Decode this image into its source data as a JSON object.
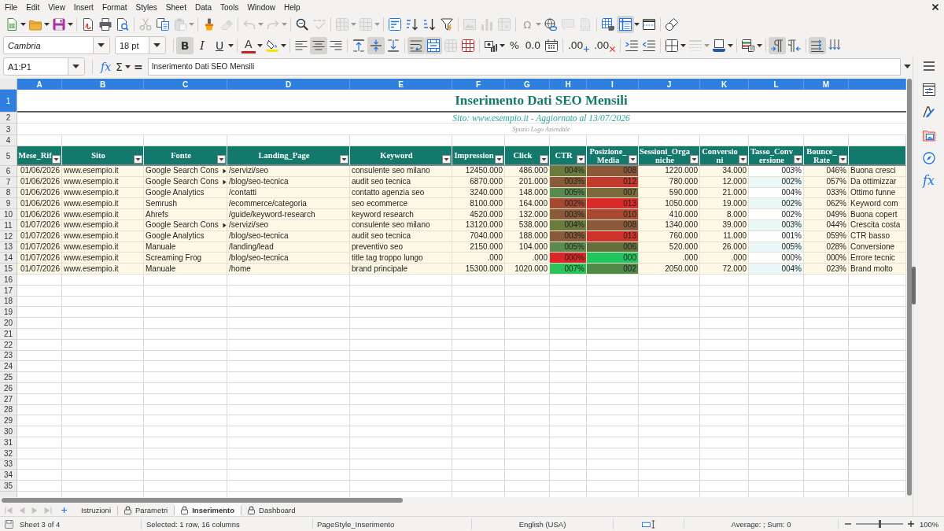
{
  "menu": [
    "File",
    "Edit",
    "View",
    "Insert",
    "Format",
    "Styles",
    "Sheet",
    "Data",
    "Tools",
    "Window",
    "Help"
  ],
  "standard_toolbar": [
    [
      {
        "pressed": false,
        "disabled": false
      },
      {
        "pressed": false,
        "disabled": false
      },
      {
        "pressed": false,
        "disabled": false
      }
    ],
    [
      {
        "pressed": false,
        "disabled": false
      },
      {
        "pressed": false,
        "disabled": false
      },
      {
        "pressed": false,
        "disabled": false
      }
    ],
    [
      {
        "pressed": false,
        "disabled": true
      },
      {
        "pressed": false,
        "disabled": false
      },
      {
        "pressed": false,
        "disabled": true
      }
    ],
    [
      {
        "pressed": false,
        "disabled": false
      },
      {
        "pressed": false,
        "disabled": true
      }
    ],
    [
      {
        "pressed": false,
        "disabled": true
      },
      {
        "pressed": false,
        "disabled": true
      }
    ],
    [
      {
        "pressed": false,
        "disabled": false
      },
      {
        "pressed": false,
        "disabled": true
      }
    ],
    [
      {
        "pressed": false,
        "disabled": true
      },
      {
        "pressed": false,
        "disabled": true
      }
    ],
    [
      {
        "pressed": false,
        "disabled": false
      },
      {
        "pressed": false,
        "disabled": false
      },
      {
        "pressed": false,
        "disabled": false
      },
      {
        "pressed": false,
        "disabled": false
      }
    ],
    [
      {
        "pressed": false,
        "disabled": true
      },
      {
        "pressed": false,
        "disabled": true
      },
      {
        "pressed": false,
        "disabled": true
      }
    ],
    [
      {
        "label": "Ω",
        "pressed": false,
        "disabled": true
      },
      {
        "pressed": false,
        "disabled": false
      },
      {
        "pressed": false,
        "disabled": true
      },
      {
        "pressed": false,
        "disabled": true
      }
    ],
    [
      {
        "pressed": false,
        "disabled": false
      },
      {
        "pressed": true,
        "disabled": false
      },
      {
        "pressed": false,
        "disabled": false
      }
    ],
    [
      {
        "pressed": false,
        "disabled": false
      }
    ]
  ],
  "formatting_toolbar": {
    "font_name": {
      "value": "Cambria"
    },
    "font_size": {
      "value": "18 pt"
    },
    "groups": [
      [
        {
          "label": "B",
          "pressed": true,
          "disabled": false
        },
        {
          "label": "I",
          "pressed": false,
          "disabled": false
        },
        {
          "label": "U",
          "pressed": false,
          "disabled": false
        }
      ],
      [
        {
          "label": "A",
          "pressed": false,
          "disabled": false
        },
        {
          "pressed": false,
          "disabled": false
        }
      ],
      [
        {
          "pressed": false,
          "disabled": false
        },
        {
          "pressed": true,
          "disabled": false
        },
        {
          "pressed": false,
          "disabled": false
        }
      ],
      [
        {
          "pressed": false,
          "disabled": false
        },
        {
          "pressed": true,
          "disabled": false
        },
        {
          "pressed": false,
          "disabled": false
        }
      ],
      [
        {
          "pressed": true,
          "disabled": false
        },
        {
          "pressed": true,
          "disabled": false
        },
        {
          "pressed": false,
          "disabled": true
        },
        {
          "pressed": false,
          "disabled": false
        }
      ],
      [
        {
          "pressed": false,
          "disabled": false
        },
        {
          "label": "%",
          "pressed": false,
          "disabled": false
        },
        {
          "label": "0.0",
          "pressed": false,
          "disabled": false
        },
        {
          "pressed": false,
          "disabled": false
        }
      ],
      [
        {
          "label": ".00",
          "pressed": false,
          "disabled": false
        },
        {
          "label": ".00",
          "pressed": false,
          "disabled": false
        }
      ],
      [
        {
          "pressed": false,
          "disabled": false
        },
        {
          "pressed": false,
          "disabled": false
        }
      ],
      [
        {
          "pressed": false,
          "disabled": false
        },
        {
          "pressed": false,
          "disabled": true
        },
        {
          "pressed": false,
          "disabled": false
        }
      ],
      [
        {
          "pressed": false,
          "disabled": false
        }
      ],
      [
        {
          "pressed": true,
          "disabled": false
        },
        {
          "pressed": false,
          "disabled": false
        }
      ],
      [
        {
          "pressed": true,
          "disabled": false
        },
        {
          "pressed": false,
          "disabled": false
        }
      ]
    ]
  },
  "formula_bar": {
    "name_box": {
      "value": "A1:P1"
    },
    "function_wizard": "fx",
    "sum": "Σ",
    "formula": "=",
    "content": {
      "value": "Inserimento Dati SEO Mensili"
    }
  },
  "sheet": {
    "column_headers": [
      {
        "label": "A",
        "selected": true
      },
      {
        "label": "B",
        "selected": true
      },
      {
        "label": "C",
        "selected": true
      },
      {
        "label": "D",
        "selected": true
      },
      {
        "label": "E",
        "selected": true
      },
      {
        "label": "F",
        "selected": true
      },
      {
        "label": "G",
        "selected": true
      },
      {
        "label": "H",
        "selected": true
      },
      {
        "label": "I",
        "selected": true
      },
      {
        "label": "J",
        "selected": true
      },
      {
        "label": "K",
        "selected": true
      },
      {
        "label": "L",
        "selected": true
      },
      {
        "label": "M",
        "selected": true
      },
      {
        "selected": true
      }
    ],
    "row_headers": [
      {
        "label": "1",
        "selected": true
      },
      {
        "label": "2",
        "selected": false
      },
      {
        "label": "3",
        "selected": false
      },
      {
        "label": "4",
        "selected": false
      },
      {
        "label": "5",
        "selected": false
      },
      {
        "label": "6",
        "selected": false
      },
      {
        "label": "7",
        "selected": false
      },
      {
        "label": "8",
        "selected": false
      },
      {
        "label": "9",
        "selected": false
      },
      {
        "label": "10",
        "selected": false
      },
      {
        "label": "11",
        "selected": false
      },
      {
        "label": "12",
        "selected": false
      },
      {
        "label": "13",
        "selected": false
      },
      {
        "label": "14",
        "selected": false
      },
      {
        "label": "15",
        "selected": false
      },
      {
        "label": "16",
        "selected": false
      },
      {
        "label": "17",
        "selected": false
      },
      {
        "label": "18",
        "selected": false
      },
      {
        "label": "19",
        "selected": false
      },
      {
        "label": "20",
        "selected": false
      },
      {
        "label": "21",
        "selected": false
      },
      {
        "label": "22",
        "selected": false
      },
      {
        "label": "23",
        "selected": false
      },
      {
        "label": "24",
        "selected": false
      },
      {
        "label": "25",
        "selected": false
      },
      {
        "label": "26",
        "selected": false
      },
      {
        "label": "27",
        "selected": false
      },
      {
        "label": "28",
        "selected": false
      },
      {
        "label": "29",
        "selected": false
      },
      {
        "label": "30",
        "selected": false
      },
      {
        "label": "31",
        "selected": false
      },
      {
        "label": "32",
        "selected": false
      },
      {
        "label": "33",
        "selected": false
      },
      {
        "label": "34",
        "selected": false
      },
      {
        "label": "35",
        "selected": false
      }
    ],
    "title": "Inserimento Dati SEO Mensili",
    "subtitle": "Sito: www.esempio.it - Aggiornato al 13/07/2026",
    "logo_placeholder": "Spazio Logo Aziendale",
    "table": {
      "columns": [
        "Mese_Rif",
        "Sito",
        "Fonte",
        "Landing_Page",
        "Keyword",
        "Impression",
        "Click",
        "CTR",
        "Posizione_Media",
        "Sessioni_Organiche",
        "Conversioni",
        "Tasso_Conversione",
        "Bounce_Rate"
      ],
      "rows": [
        {
          "mese_rif": "01/06/2026",
          "sito": "www.esempio.it",
          "fonte": "Google Search Cons",
          "fonte_clipped": true,
          "landing_page": "/servizi/seo",
          "keyword": "consulente seo milano",
          "impression": "12450.000",
          "click": "486.000",
          "ctr": {
            "text": "004%",
            "color": "#6b7b3c"
          },
          "posizione_media": {
            "text": "008",
            "color": "#8b5a3a"
          },
          "sessioni_organiche": "1220.000",
          "conversioni": "34.000",
          "tasso_conversione": "003%",
          "bounce_rate": "046%",
          "column_14": "Buona cresci"
        },
        {
          "mese_rif": "01/06/2026",
          "sito": "www.esempio.it",
          "fonte": "Google Search Cons",
          "fonte_clipped": true,
          "landing_page": "/blog/seo-tecnica",
          "keyword": "audit seo tecnica",
          "impression": "6870.000",
          "click": "201.000",
          "ctr": {
            "text": "003%",
            "color": "#8a5b38"
          },
          "posizione_media": {
            "text": "012",
            "color": "#c23b2c"
          },
          "sessioni_organiche": "780.000",
          "conversioni": "12.000",
          "tasso_conversione": "002%",
          "bounce_rate": "057%",
          "column_14": "Da ottimizzar"
        },
        {
          "mese_rif": "01/06/2026",
          "sito": "www.esempio.it",
          "fonte": "Google Analytics",
          "fonte_clipped": false,
          "landing_page": "/contatti",
          "keyword": "contatto agenzia seo",
          "impression": "3240.000",
          "click": "148.000",
          "ctr": {
            "text": "005%",
            "color": "#5a8a4c"
          },
          "posizione_media": {
            "text": "007",
            "color": "#7c6a3a"
          },
          "sessioni_organiche": "590.000",
          "conversioni": "21.000",
          "tasso_conversione": "004%",
          "bounce_rate": "033%",
          "column_14": "Ottimo funne"
        },
        {
          "mese_rif": "01/06/2026",
          "sito": "www.esempio.it",
          "fonte": "Semrush",
          "fonte_clipped": false,
          "landing_page": "/ecommerce/categoria",
          "keyword": "seo ecommerce",
          "impression": "8100.000",
          "click": "164.000",
          "ctr": {
            "text": "002%",
            "color": "#a4482f"
          },
          "posizione_media": {
            "text": "013",
            "color": "#da2a28"
          },
          "sessioni_organiche": "1050.000",
          "conversioni": "19.000",
          "tasso_conversione": "002%",
          "bounce_rate": "062%",
          "column_14": "Keyword com"
        },
        {
          "mese_rif": "01/06/2026",
          "sito": "www.esempio.it",
          "fonte": "Ahrefs",
          "fonte_clipped": false,
          "landing_page": "/guide/keyword-research",
          "keyword": "keyword research",
          "impression": "4520.000",
          "click": "132.000",
          "ctr": {
            "text": "003%",
            "color": "#8a5b38"
          },
          "posizione_media": {
            "text": "010",
            "color": "#a94a30"
          },
          "sessioni_organiche": "410.000",
          "conversioni": "8.000",
          "tasso_conversione": "002%",
          "bounce_rate": "049%",
          "column_14": "Buona copert"
        },
        {
          "mese_rif": "01/07/2026",
          "sito": "www.esempio.it",
          "fonte": "Google Search Cons",
          "fonte_clipped": true,
          "landing_page": "/servizi/seo",
          "keyword": "consulente seo milano",
          "impression": "13120.000",
          "click": "538.000",
          "ctr": {
            "text": "004%",
            "color": "#6b7b3c"
          },
          "posizione_media": {
            "text": "008",
            "color": "#8b5a3a"
          },
          "sessioni_organiche": "1340.000",
          "conversioni": "39.000",
          "tasso_conversione": "003%",
          "bounce_rate": "044%",
          "column_14": "Crescita costa"
        },
        {
          "mese_rif": "01/07/2026",
          "sito": "www.esempio.it",
          "fonte": "Google Analytics",
          "fonte_clipped": false,
          "landing_page": "/blog/seo-tecnica",
          "keyword": "audit seo tecnica",
          "impression": "7040.000",
          "click": "188.000",
          "ctr": {
            "text": "003%",
            "color": "#8a5b38"
          },
          "posizione_media": {
            "text": "013",
            "color": "#cf3229"
          },
          "sessioni_organiche": "760.000",
          "conversioni": "11.000",
          "tasso_conversione": "001%",
          "bounce_rate": "059%",
          "column_14": "CTR basso"
        },
        {
          "mese_rif": "01/07/2026",
          "sito": "www.esempio.it",
          "fonte": "Manuale",
          "fonte_clipped": false,
          "landing_page": "/landing/lead",
          "keyword": "preventivo seo",
          "impression": "2150.000",
          "click": "104.000",
          "ctr": {
            "text": "005%",
            "color": "#5a8a4c"
          },
          "posizione_media": {
            "text": "006",
            "color": "#646f3c"
          },
          "sessioni_organiche": "520.000",
          "conversioni": "26.000",
          "tasso_conversione": "005%",
          "bounce_rate": "028%",
          "column_14": "Conversione"
        },
        {
          "mese_rif": "01/07/2026",
          "sito": "www.esempio.it",
          "fonte": "Screaming Frog",
          "fonte_clipped": false,
          "landing_page": "/blog/seo-tecnica",
          "keyword": "title tag troppo lungo",
          "impression": ".000",
          "click": ".000",
          "ctr": {
            "text": "000%",
            "color": "#dc2626"
          },
          "posizione_media": {
            "text": "000",
            "color": "#22c55e"
          },
          "sessioni_organiche": ".000",
          "conversioni": ".000",
          "tasso_conversione": "000%",
          "bounce_rate": "000%",
          "column_14": "Errore tecnic"
        },
        {
          "mese_rif": "01/07/2026",
          "sito": "www.esempio.it",
          "fonte": "Manuale",
          "fonte_clipped": false,
          "landing_page": "/home",
          "keyword": "brand principale",
          "impression": "15300.000",
          "click": "1020.000",
          "ctr": {
            "text": "007%",
            "color": "#2bc45b"
          },
          "posizione_media": {
            "text": "002",
            "color": "#4f8a46"
          },
          "sessioni_organiche": "2050.000",
          "conversioni": "72.000",
          "tasso_conversione": "004%",
          "bounce_rate": "023%",
          "column_14": "Brand molto"
        }
      ]
    }
  },
  "tab_navigation": [
    {
      "disabled": true
    },
    {
      "disabled": true
    },
    {
      "disabled": true
    },
    {
      "disabled": true
    }
  ],
  "sheet_tabs": [
    {
      "label": "Istruzioni",
      "protected": false,
      "selected": false
    },
    {
      "label": "Parametri",
      "protected": true,
      "selected": false
    },
    {
      "label": "Inserimento",
      "protected": true,
      "selected": true
    },
    {
      "label": "Dashboard",
      "protected": true,
      "selected": false
    }
  ],
  "sidebar": {
    "functions": "fx"
  },
  "status_bar": {
    "sheet": "Sheet 3 of 4",
    "selection": "Selected: 1 row, 16 columns",
    "page_style": "PageStyle_Inserimento",
    "language": "English (USA)",
    "summary": "Average: ; Sum: 0",
    "zoom_slider": {
      "level": 0.5
    },
    "zoom_percent": "100%"
  }
}
